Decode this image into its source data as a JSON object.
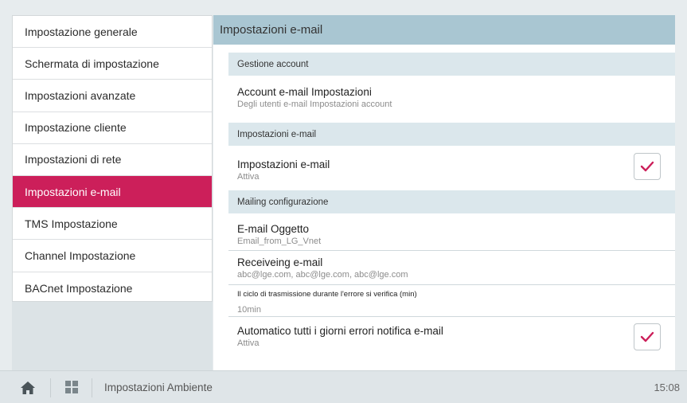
{
  "sidebar": {
    "items": [
      {
        "label": "Impostazione generale"
      },
      {
        "label": "Schermata di impostazione"
      },
      {
        "label": "Impostazioni avanzate"
      },
      {
        "label": "Impostazione cliente"
      },
      {
        "label": "Impostazioni di rete"
      },
      {
        "label": "Impostazioni e-mail",
        "active": true
      },
      {
        "label": "TMS Impostazione"
      },
      {
        "label": "Channel Impostazione"
      },
      {
        "label": "BACnet Impostazione"
      }
    ]
  },
  "panel": {
    "title": "Impostazioni e-mail",
    "sections": {
      "account": {
        "header": "Gestione account",
        "row_title": "Account e-mail Impostazioni",
        "row_sub": "Degli utenti e-mail Impostazioni account"
      },
      "email": {
        "header": "Impostazioni e-mail",
        "row_title": "Impostazioni e-mail",
        "row_sub": "Attiva",
        "checked": true
      },
      "mailing": {
        "header": "Mailing configurazione",
        "subject_title": "E-mail Oggetto",
        "subject_value": "Email_from_LG_Vnet",
        "receive_title": "Receiveing e-mail",
        "receive_value": "abc@lge.com,  abc@lge.com,  abc@lge.com",
        "cycle_title": "Il ciclo di trasmissione durante l'errore si verifica (min)",
        "cycle_value": "10min",
        "daily_title": "Automatico tutti i giorni errori notifica e-mail",
        "daily_value": "Attiva",
        "daily_checked": true
      }
    }
  },
  "bottombar": {
    "title": "Impostazioni Ambiente",
    "time": "15:08"
  },
  "colors": {
    "accent": "#cc1f5a",
    "header": "#a9c6d2",
    "section": "#dbe7ec"
  },
  "icons": {
    "check": "✓"
  }
}
